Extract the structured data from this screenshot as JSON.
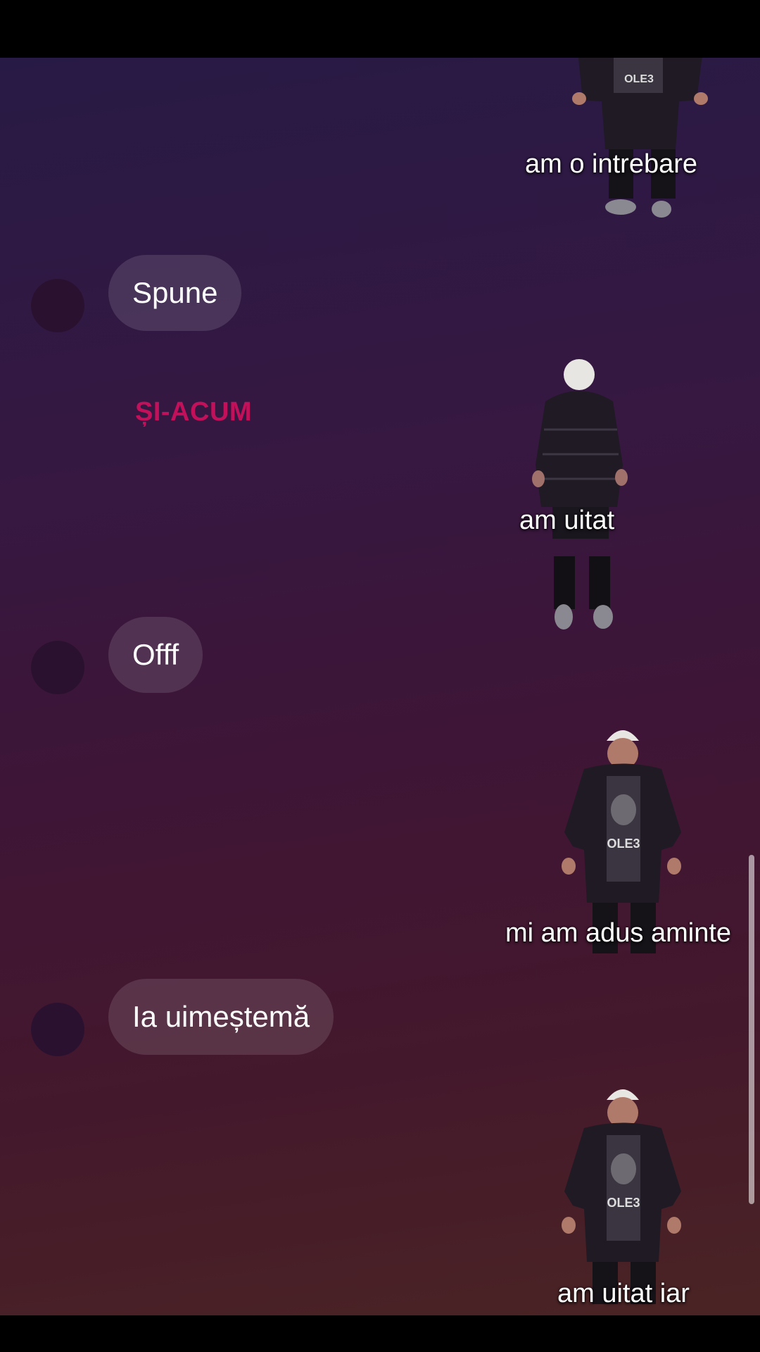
{
  "messages": [
    {
      "text": "Spune"
    },
    {
      "text": "Offf"
    },
    {
      "text": "Ia uimeștemă"
    }
  ],
  "overlay_word": "ȘI-ACUM",
  "stickers": [
    {
      "caption": "am o intrebare"
    },
    {
      "caption": "am uitat"
    },
    {
      "caption": "mi am adus aminte"
    },
    {
      "caption": "am uitat iar"
    }
  ],
  "shirt_print": "OLE3",
  "colors": {
    "bubble": "rgba(255,255,255,0.12)",
    "overlay_word": "#c2105a",
    "jacket": "#1f1a24",
    "hat": "#e8e6e2"
  }
}
